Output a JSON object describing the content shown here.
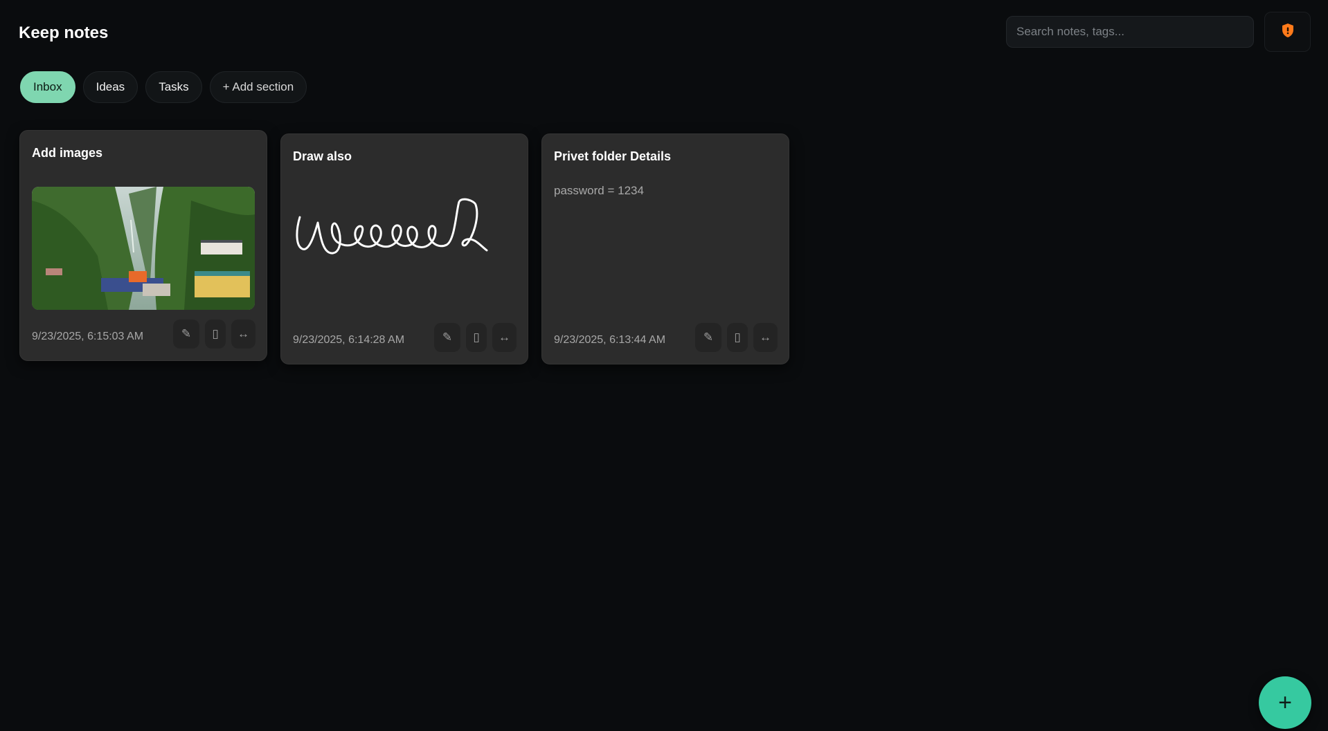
{
  "header": {
    "title": "Keep notes",
    "search_placeholder": "Search notes, tags...",
    "lock_icon": "shield-lock-icon"
  },
  "tabs": [
    {
      "label": "Inbox",
      "active": true
    },
    {
      "label": "Ideas",
      "active": false
    },
    {
      "label": "Tasks",
      "active": false
    },
    {
      "label": "+ Add section",
      "active": false
    }
  ],
  "notes": [
    {
      "title": "Add images",
      "date": "9/23/2025, 6:15:03 AM",
      "content_type": "image"
    },
    {
      "title": "Draw also",
      "date": "9/23/2025, 6:14:28 AM",
      "content_type": "drawing"
    },
    {
      "title": "Privet folder Details",
      "body": "password = 1234",
      "date": "9/23/2025, 6:13:44 AM",
      "content_type": "text"
    }
  ],
  "note_actions": [
    "pencil-icon",
    "trash-icon",
    "move-arrows-icon"
  ],
  "fab": {
    "label": "+"
  },
  "colors": {
    "accent": "#7fd6b0",
    "fab": "#36c9a0",
    "card": "#2c2c2c",
    "background": "#0a0c0e",
    "shield": "#ff7a1a"
  }
}
